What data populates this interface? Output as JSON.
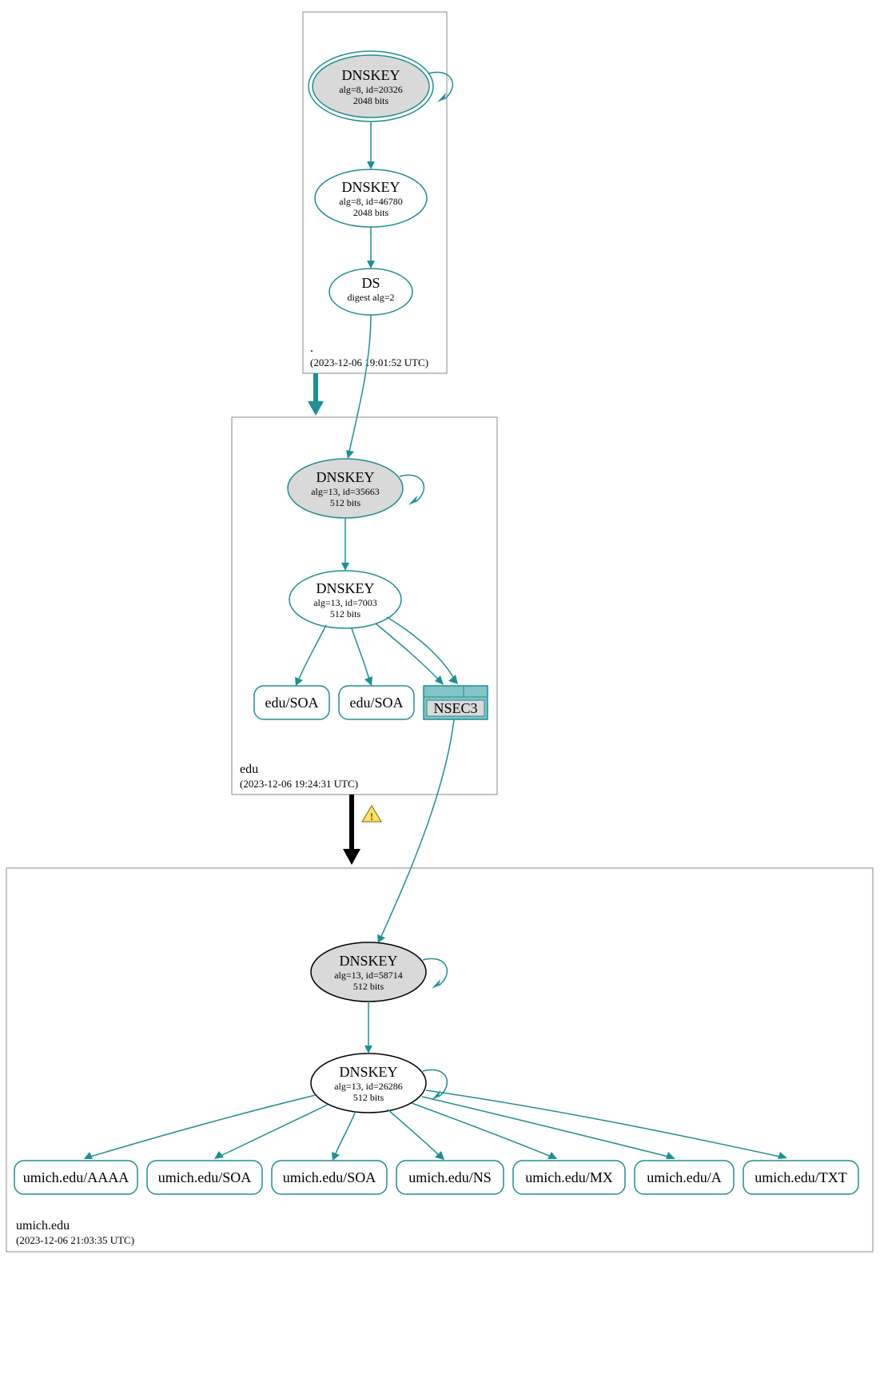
{
  "colors": {
    "teal": "#1f8f93",
    "gray_fill": "#d9d9d9",
    "box_stroke": "#888888",
    "nsec3_fill": "#82c4c7",
    "warn_fill": "#ffe26a",
    "warn_stroke": "#7a6a00"
  },
  "zones": {
    "root": {
      "name_label": ".",
      "timestamp": "(2023-12-06 19:01:52 UTC)",
      "ksk": {
        "title": "DNSKEY",
        "line1": "alg=8, id=20326",
        "line2": "2048 bits"
      },
      "zsk": {
        "title": "DNSKEY",
        "line1": "alg=8, id=46780",
        "line2": "2048 bits"
      },
      "ds": {
        "title": "DS",
        "line1": "digest alg=2"
      }
    },
    "edu": {
      "name_label": "edu",
      "timestamp": "(2023-12-06 19:24:31 UTC)",
      "ksk": {
        "title": "DNSKEY",
        "line1": "alg=13, id=35663",
        "line2": "512 bits"
      },
      "zsk": {
        "title": "DNSKEY",
        "line1": "alg=13, id=7003",
        "line2": "512 bits"
      },
      "rrsets": {
        "soa1": "edu/SOA",
        "soa2": "edu/SOA",
        "nsec3": "NSEC3"
      }
    },
    "umich": {
      "name_label": "umich.edu",
      "timestamp": "(2023-12-06 21:03:35 UTC)",
      "ksk": {
        "title": "DNSKEY",
        "line1": "alg=13, id=58714",
        "line2": "512 bits"
      },
      "zsk": {
        "title": "DNSKEY",
        "line1": "alg=13, id=26286",
        "line2": "512 bits"
      },
      "rrsets": {
        "aaaa": "umich.edu/AAAA",
        "soa1": "umich.edu/SOA",
        "soa2": "umich.edu/SOA",
        "ns": "umich.edu/NS",
        "mx": "umich.edu/MX",
        "a": "umich.edu/A",
        "txt": "umich.edu/TXT"
      }
    }
  },
  "warning_icon": "!"
}
